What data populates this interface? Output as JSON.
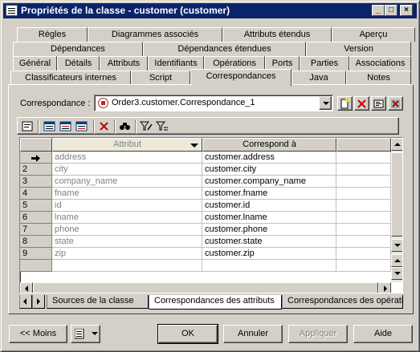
{
  "window": {
    "title": "Propriétés de la classe - customer (customer)",
    "controls": {
      "minimize": "_",
      "maximize": "□",
      "close": "×"
    }
  },
  "tabs": {
    "row1": [
      "Règles",
      "Diagrammes associés",
      "Attributs étendus",
      "Aperçu"
    ],
    "row2": [
      "Dépendances",
      "Dépendances étendues",
      "Version"
    ],
    "row3": [
      "Général",
      "Détails",
      "Attributs",
      "Identifiants",
      "Opérations",
      "Ports",
      "Parties",
      "Associations"
    ],
    "row4": [
      "Classificateurs internes",
      "Script",
      "Correspondances",
      "Java",
      "Notes"
    ],
    "active": "Correspondances"
  },
  "correspondance": {
    "label": "Correspondance :",
    "value": "Order3.customer.Correspondance_1"
  },
  "grid": {
    "headers": {
      "attribute": "Attribut",
      "mapped_to": "Correspond à"
    },
    "rows": [
      {
        "num": "",
        "attribute": "address",
        "mapped_to": "customer.address",
        "current": true
      },
      {
        "num": "2",
        "attribute": "city",
        "mapped_to": "customer.city"
      },
      {
        "num": "3",
        "attribute": "company_name",
        "mapped_to": "customer.company_name"
      },
      {
        "num": "4",
        "attribute": "fname",
        "mapped_to": "customer.fname"
      },
      {
        "num": "5",
        "attribute": "id",
        "mapped_to": "customer.id"
      },
      {
        "num": "6",
        "attribute": "lname",
        "mapped_to": "customer.lname"
      },
      {
        "num": "7",
        "attribute": "phone",
        "mapped_to": "customer.phone"
      },
      {
        "num": "8",
        "attribute": "state",
        "mapped_to": "customer.state"
      },
      {
        "num": "9",
        "attribute": "zip",
        "mapped_to": "customer.zip"
      }
    ]
  },
  "bottom_tabs": [
    "Sources de la classe",
    "Correspondances des attributs",
    "Correspondances des opérations"
  ],
  "bottom_tabs_active": 1,
  "buttons": {
    "less": "<< Moins",
    "ok": "OK",
    "cancel": "Annuler",
    "apply": "Appliquer",
    "help": "Aide"
  },
  "colors": {
    "titlebar": "#0a246a",
    "face": "#d4d0c8",
    "delete_red": "#c00000"
  }
}
